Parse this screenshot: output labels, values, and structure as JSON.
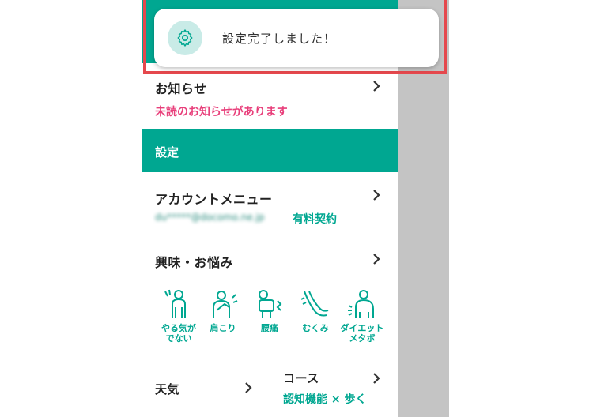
{
  "toast": {
    "message": "設定完了しました！",
    "icon": "gear-icon"
  },
  "notice": {
    "title": "お知らせ",
    "status": "未読のお知らせがあります"
  },
  "settings_header": "設定",
  "account": {
    "title": "アカウントメニュー",
    "email": "du*****@docomo.ne.jp",
    "plan": "有料契約"
  },
  "concerns": {
    "title": "興味・お悩み",
    "items": [
      {
        "label": "やる気が\nでない",
        "icon": "unmotivated-person-icon"
      },
      {
        "label": "肩こり",
        "icon": "shoulder-pain-icon"
      },
      {
        "label": "腰痛",
        "icon": "back-pain-icon"
      },
      {
        "label": "むくみ",
        "icon": "swollen-legs-icon"
      },
      {
        "label": "ダイエット\nメタボ",
        "icon": "diet-person-icon"
      }
    ]
  },
  "weather": {
    "title": "天気"
  },
  "course": {
    "title": "コース",
    "subtitle": "認知機能 × 歩く"
  },
  "colors": {
    "accent": "#00a791",
    "pink": "#e83e7a",
    "highlight": "#e5484d"
  }
}
